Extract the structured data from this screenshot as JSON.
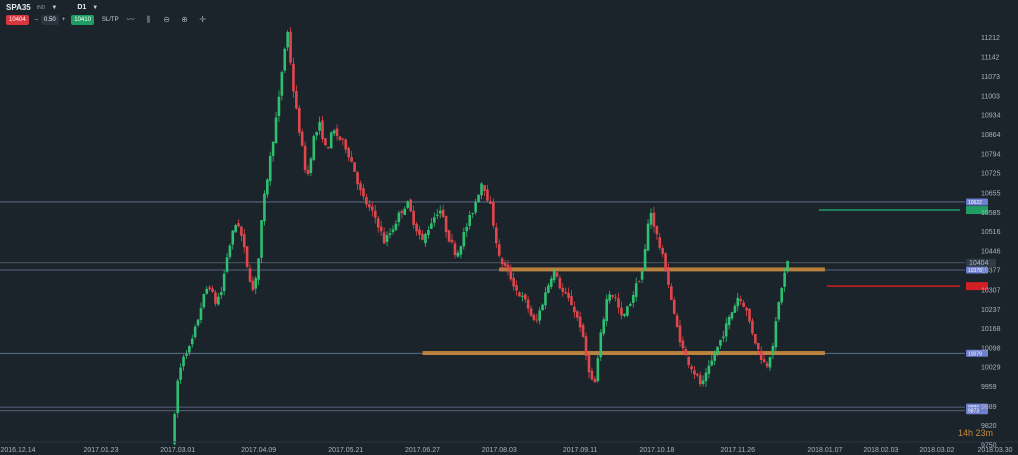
{
  "toolbar": {
    "symbol": "SPA35",
    "symbol_sub": "IND",
    "timeframe": "D1",
    "sell_price": "10404",
    "quantity": "0.50",
    "buy_price": "10410",
    "sltp_label": "SL/TP",
    "tools": [
      "line-chart-icon",
      "bar-chart-icon",
      "zoom-out-icon",
      "zoom-in-icon",
      "crosshair-icon"
    ]
  },
  "colors": {
    "background": "#1b232b",
    "bull": "#2fbf71",
    "bear": "#e0474c",
    "support": "#c98a3d",
    "level_line": "#7c8fb3",
    "tp": "#1f9d63",
    "sl": "#d11f24",
    "price_tag": "#2f3b47",
    "level_tag": "#6e7fd0"
  },
  "countdown": "14h 23m",
  "chart_data": {
    "type": "candlestick",
    "y_ticks": [
      "11212",
      "11142",
      "11073",
      "11003",
      "10934",
      "10864",
      "10794",
      "10725",
      "10655",
      "10585",
      "10516",
      "10446",
      "10377",
      "10307",
      "10237",
      "10168",
      "10098",
      "10029",
      "9959",
      "9889",
      "9820",
      "9750"
    ],
    "y_tick_values": [
      11212,
      11142,
      11073,
      11003,
      10934,
      10864,
      10794,
      10725,
      10655,
      10585,
      10516,
      10446,
      10377,
      10307,
      10237,
      10168,
      10098,
      10029,
      9959,
      9889,
      9820,
      9750
    ],
    "ylim": [
      9750,
      11282
    ],
    "x_ticks": [
      "2016.12.14",
      "2017.01.23",
      "2017.03.01",
      "2017.04.09",
      "2017.05.21",
      "2017.06.27",
      "2017.08.03",
      "2017.09.11",
      "2017.10.18",
      "2017.11.26",
      "2018.01.07",
      "2018.02.03",
      "2018.03.02",
      "2018.03.30"
    ],
    "current_price": "10404",
    "horizontal_levels": [
      {
        "label": "10622",
        "value": 10622
      },
      {
        "label": "10378",
        "value": 10378
      },
      {
        "label": "10079",
        "value": 10079
      },
      {
        "label": "9886",
        "value": 9886
      },
      {
        "label": "9873",
        "value": 9873
      }
    ],
    "support_zones": [
      {
        "value": 10380,
        "from": "2017.08.03",
        "to": "2018.01.07"
      },
      {
        "value": 10080,
        "from": "2017.06.27",
        "to": "2018.01.07"
      }
    ],
    "take_profit": 10593,
    "stop_loss": 10320,
    "segments": [
      {
        "from": "2017.02.26",
        "to": "2017.03.01",
        "v": [
          9760,
          9800,
          9850,
          9900,
          9980
        ]
      },
      {
        "from": "2017.03.01",
        "to": "2017.03.22",
        "v": [
          9980,
          10080,
          10100,
          10180,
          10270,
          10330,
          10260,
          10300
        ]
      },
      {
        "from": "2017.03.22",
        "to": "2017.04.09",
        "v": [
          10300,
          10420,
          10500,
          10560,
          10480,
          10380,
          10300,
          10420
        ]
      },
      {
        "from": "2017.04.09",
        "to": "2017.04.23",
        "v": [
          10420,
          10600,
          10700,
          10800,
          10900,
          11000,
          11150,
          11230
        ]
      },
      {
        "from": "2017.04.23",
        "to": "2017.05.21",
        "v": [
          11230,
          11000,
          10850,
          10700,
          10850,
          10900,
          10800,
          10880,
          10850,
          10820
        ]
      },
      {
        "from": "2017.05.21",
        "to": "2017.06.27",
        "v": [
          10820,
          10750,
          10650,
          10600,
          10560,
          10480,
          10520,
          10580,
          10620,
          10540,
          10480
        ]
      },
      {
        "from": "2017.06.27",
        "to": "2017.08.03",
        "v": [
          10480,
          10550,
          10600,
          10500,
          10430,
          10520,
          10600,
          10700,
          10600,
          10420
        ]
      },
      {
        "from": "2017.08.03",
        "to": "2017.09.11",
        "v": [
          10420,
          10370,
          10300,
          10260,
          10180,
          10280,
          10380,
          10300,
          10260,
          10180
        ]
      },
      {
        "from": "2017.09.11",
        "to": "2017.10.18",
        "v": [
          10180,
          10050,
          9950,
          10150,
          10300,
          10280,
          10200,
          10250,
          10320,
          10380,
          10600,
          10500
        ]
      },
      {
        "from": "2017.10.18",
        "to": "2017.11.26",
        "v": [
          10500,
          10380,
          10200,
          10080,
          10020,
          9960,
          10040,
          10120,
          10200,
          10280
        ]
      },
      {
        "from": "2017.11.26",
        "to": "2017.12.20",
        "v": [
          10280,
          10250,
          10160,
          10080,
          10030,
          10120,
          10300,
          10410
        ]
      }
    ]
  }
}
